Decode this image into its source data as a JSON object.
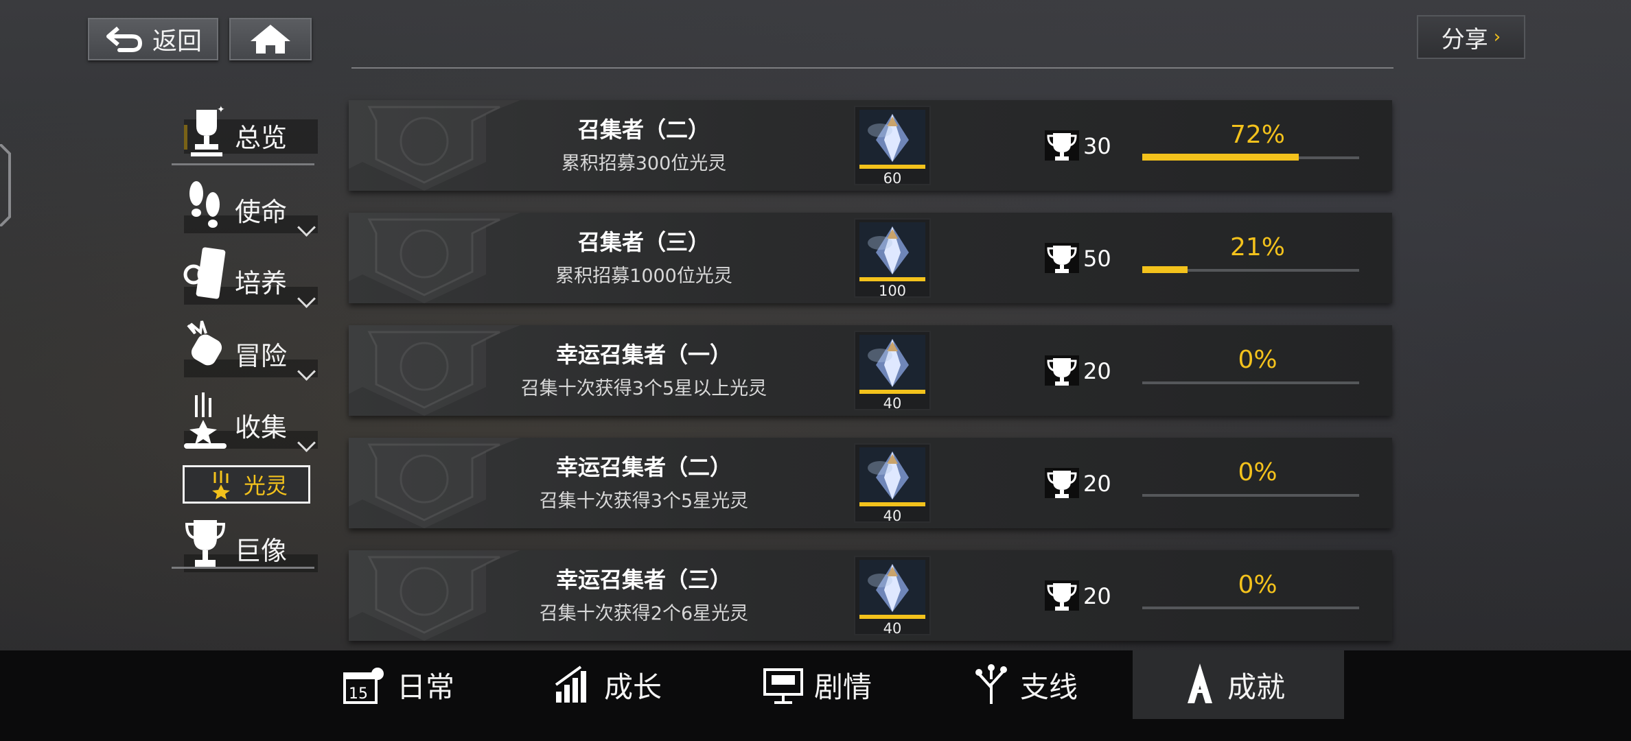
{
  "header": {
    "back_label": "返回",
    "share_label": "分享"
  },
  "sidebar": {
    "overview": "总览",
    "items": [
      {
        "label": "使命"
      },
      {
        "label": "培养"
      },
      {
        "label": "冒险"
      },
      {
        "label": "收集"
      }
    ],
    "sub_selected": "光灵",
    "last": "巨像"
  },
  "achievements": [
    {
      "title": "召集者（二）",
      "desc": "累积招募300位光灵",
      "reward_qty": "60",
      "trophy": "30",
      "percent": "72%",
      "progress": 0.72
    },
    {
      "title": "召集者（三）",
      "desc": "累积招募1000位光灵",
      "reward_qty": "100",
      "trophy": "50",
      "percent": "21%",
      "progress": 0.21
    },
    {
      "title": "幸运召集者（一）",
      "desc": "召集十次获得3个5星以上光灵",
      "reward_qty": "40",
      "trophy": "20",
      "percent": "0%",
      "progress": 0
    },
    {
      "title": "幸运召集者（二）",
      "desc": "召集十次获得3个5星光灵",
      "reward_qty": "40",
      "trophy": "20",
      "percent": "0%",
      "progress": 0
    },
    {
      "title": "幸运召集者（三）",
      "desc": "召集十次获得2个6星光灵",
      "reward_qty": "40",
      "trophy": "20",
      "percent": "0%",
      "progress": 0
    }
  ],
  "bottom_nav": [
    {
      "label": "日常",
      "icon": "calendar-icon"
    },
    {
      "label": "成长",
      "icon": "growth-chart-icon"
    },
    {
      "label": "剧情",
      "icon": "story-monitor-icon"
    },
    {
      "label": "支线",
      "icon": "branch-icon"
    },
    {
      "label": "成就",
      "icon": "achievement-icon",
      "active": true
    }
  ],
  "colors": {
    "accent": "#f3c21c",
    "panel": "#2a2b2c",
    "nav_bg": "#0b0b0c"
  }
}
